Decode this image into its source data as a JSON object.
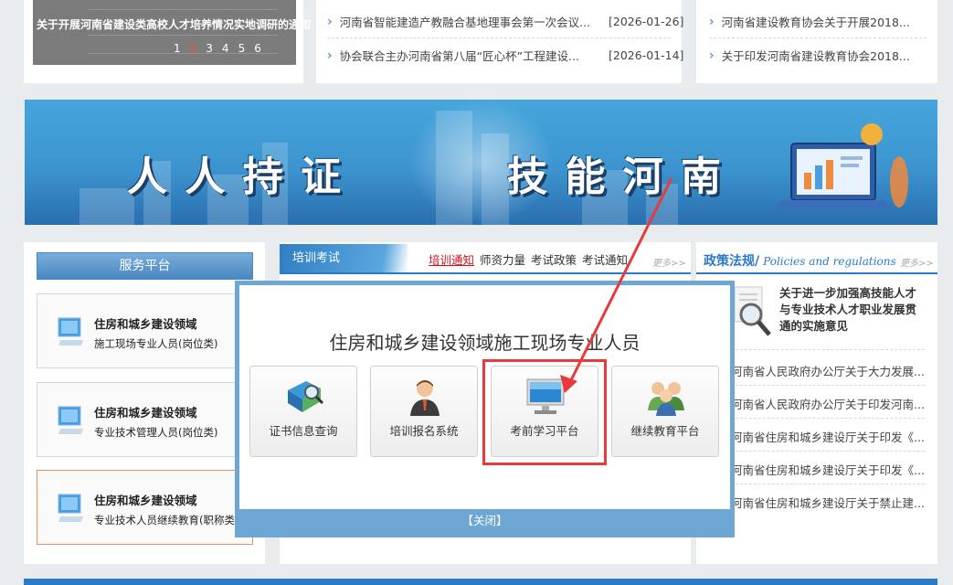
{
  "slider": {
    "caption": "关于开展河南省建设类高校人才培养情况实地调研的通知",
    "pages": [
      "1",
      "2",
      "3",
      "4",
      "5",
      "6"
    ],
    "active_page": "2"
  },
  "news_top": [
    {
      "title": "河南省智能建造产教融合基地理事会第一次会议...",
      "date": "[2026-01-26]"
    },
    {
      "title": "协会联合主办河南省第八届“匠心杯”工程建设...",
      "date": "[2026-01-14]"
    }
  ],
  "news_top_right": [
    {
      "title": "河南省建设教育协会关于开展2018..."
    },
    {
      "title": "关于印发河南省建设教育协会2018..."
    }
  ],
  "banner": {
    "left_text": "人 人 持 证",
    "right_text": "技 能 河 南"
  },
  "service": {
    "header": "服务平台",
    "items": [
      {
        "line1": "住房和城乡建设领域",
        "line2": "施工现场专业人员(岗位类)"
      },
      {
        "line1": "住房和城乡建设领域",
        "line2": "专业技术管理人员(岗位类)"
      },
      {
        "line1": "住房和城乡建设领域",
        "line2": "专业技术人员继续教育(职称类"
      }
    ]
  },
  "training": {
    "tab": "培训考试",
    "links": [
      "培训通知",
      "师资力量",
      "考试政策",
      "考试通知"
    ],
    "active_link": "培训通知",
    "more": "更多>>"
  },
  "policy": {
    "title_cn": "政策法规/",
    "title_en": "Policies and regulations",
    "more": "更多>>",
    "feature": "关于进一步加强高技能人才与专业技术人才职业发展贯通的实施意见",
    "rows": [
      "河南省人民政府办公厅关于大力发展...",
      "河南省人民政府办公厅关于印发河南...",
      "河南省住房和城乡建设厅关于印发《...",
      "河南省住房和城乡建设厅关于印发《...",
      "河南省住房和城乡建设厅关于禁止建..."
    ]
  },
  "modal": {
    "title": "住房和城乡建设领域施工现场专业人员",
    "tiles": [
      {
        "label": "证书信息查询",
        "icon": "book-search-icon"
      },
      {
        "label": "培训报名系统",
        "icon": "person-icon"
      },
      {
        "label": "考前学习平台",
        "icon": "monitor-icon"
      },
      {
        "label": "继续教育平台",
        "icon": "group-icon"
      }
    ],
    "close": "【关闭】"
  },
  "colors": {
    "accent": "#2a7ac7",
    "modal_border": "#6ea6d4",
    "highlight": "#e83a3a"
  }
}
